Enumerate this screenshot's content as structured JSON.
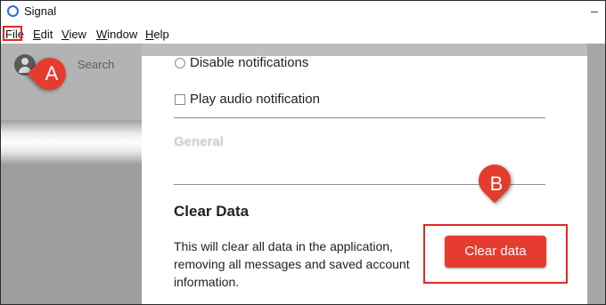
{
  "window": {
    "title": "Signal",
    "minimize_glyph": "–"
  },
  "menu": {
    "items": [
      {
        "label": "File",
        "underline": "F",
        "rest": "ile"
      },
      {
        "label": "Edit",
        "underline": "E",
        "rest": "dit"
      },
      {
        "label": "View",
        "underline": "V",
        "rest": "iew"
      },
      {
        "label": "Window",
        "underline": "W",
        "rest": "indow"
      },
      {
        "label": "Help",
        "underline": "H",
        "rest": "elp"
      }
    ]
  },
  "sidebar": {
    "search_label": "Search"
  },
  "settings": {
    "disable_notifications_label": "Disable notifications",
    "play_audio_label": "Play audio notification",
    "general_heading": "General",
    "clear_data": {
      "heading": "Clear Data",
      "description": "This will clear all data in the application, removing all messages and saved account information.",
      "button_label": "Clear data"
    }
  },
  "annotations": {
    "callout_a": "A",
    "callout_b": "B"
  },
  "colors": {
    "accent_red": "#e53c2f",
    "highlight_red": "#e02828",
    "signal_blue": "#2c6bed"
  }
}
